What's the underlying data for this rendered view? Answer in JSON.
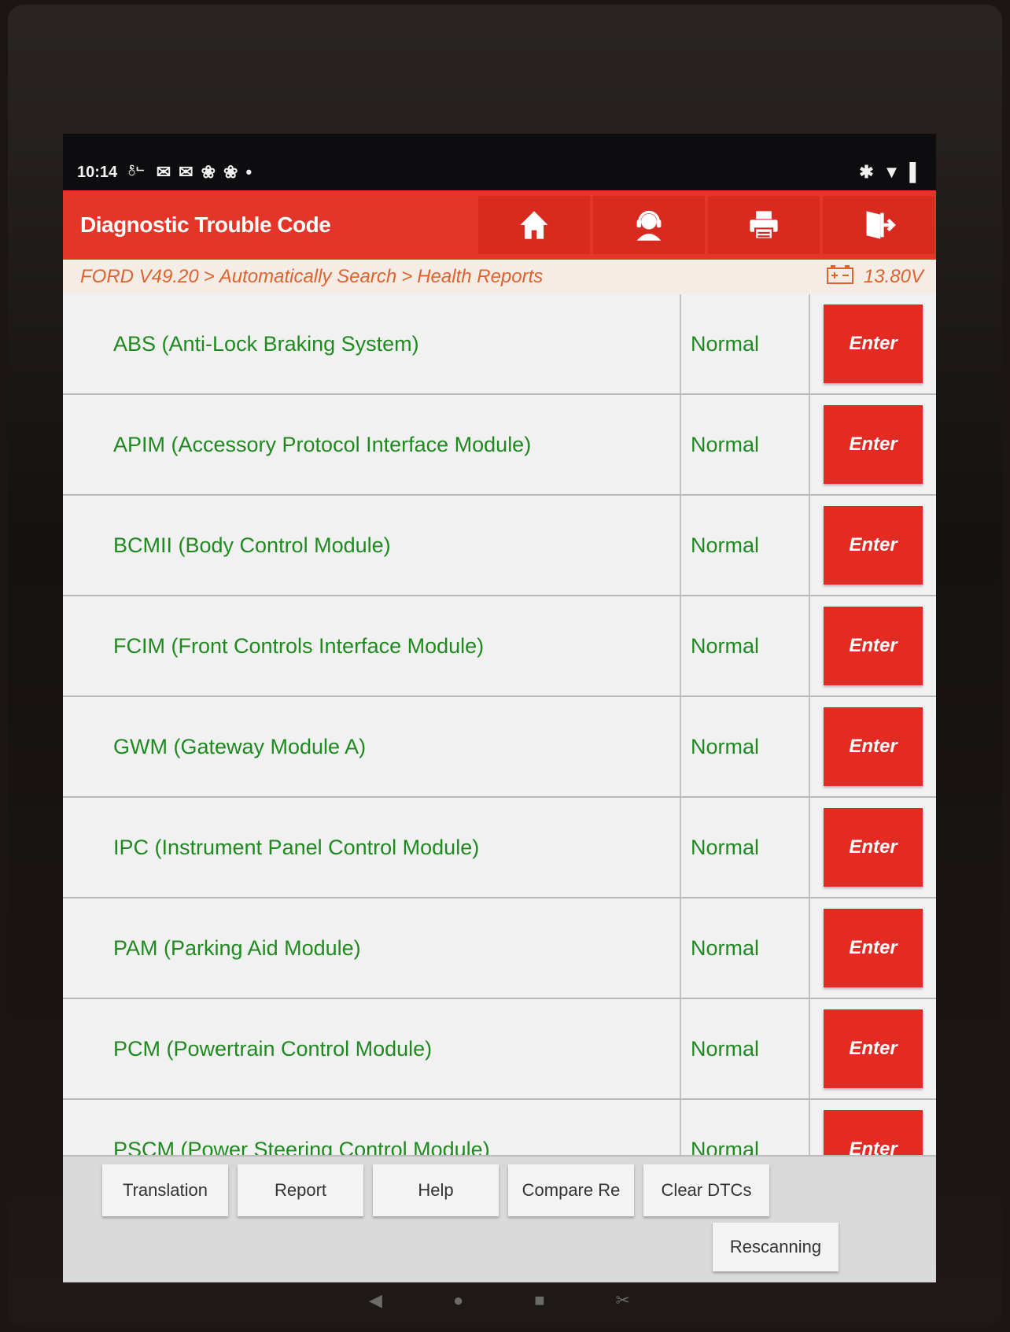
{
  "status_bar": {
    "time": "10:14",
    "carrier": "ႅᄂ",
    "notification_icons": [
      "gmail-icon",
      "gmail-icon",
      "fan-icon",
      "fan-icon",
      "dot-icon"
    ],
    "system_icons": [
      "bluetooth-icon",
      "wifi-icon",
      "battery-icon"
    ]
  },
  "header": {
    "title": "Diagnostic Trouble Code",
    "tools": [
      "home-icon",
      "support-icon",
      "print-icon",
      "exit-icon"
    ]
  },
  "breadcrumb": {
    "items": [
      "FORD V49.20",
      "Automatically Search",
      "Health Reports"
    ],
    "separator": ">"
  },
  "voltage": "13.80V",
  "modules": [
    {
      "name": "ABS (Anti-Lock Braking System)",
      "status": "Normal",
      "action": "Enter"
    },
    {
      "name": "APIM (Accessory Protocol Interface Module)",
      "status": "Normal",
      "action": "Enter"
    },
    {
      "name": "BCMII (Body Control Module)",
      "status": "Normal",
      "action": "Enter"
    },
    {
      "name": "FCIM (Front Controls Interface Module)",
      "status": "Normal",
      "action": "Enter"
    },
    {
      "name": "GWM (Gateway Module A)",
      "status": "Normal",
      "action": "Enter"
    },
    {
      "name": "IPC (Instrument Panel Control Module)",
      "status": "Normal",
      "action": "Enter"
    },
    {
      "name": "PAM (Parking Aid Module)",
      "status": "Normal",
      "action": "Enter"
    },
    {
      "name": "PCM (Powertrain Control Module)",
      "status": "Normal",
      "action": "Enter"
    },
    {
      "name": "PSCM (Power Steering Control Module)",
      "status": "Normal",
      "action": "Enter"
    }
  ],
  "actions": {
    "translation": "Translation",
    "report": "Report",
    "help": "Help",
    "compare": "Compare Re",
    "clear_dtcs": "Clear DTCs",
    "rescanning": "Rescanning"
  },
  "colors": {
    "header_red": "#e53528",
    "button_red": "#e42b23",
    "status_green": "#1f8a1f",
    "breadcrumb_orange": "#e0622c"
  }
}
